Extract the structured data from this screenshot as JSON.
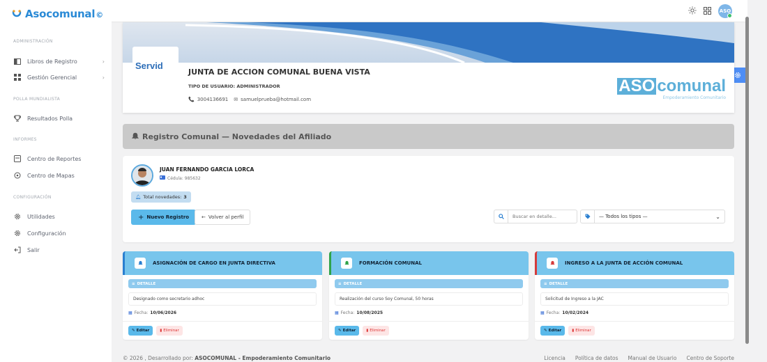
{
  "brand": {
    "name": "Asocomunal",
    "mark": "©"
  },
  "sidebar": {
    "sections": [
      {
        "label": "ADMINISTRACIÓN"
      },
      {
        "label": "POLLA MUNDIALISTA"
      },
      {
        "label": "INFORMES"
      },
      {
        "label": "CONFIGURACIÓN"
      }
    ],
    "items": [
      {
        "label": "Libros de Registro",
        "icon": "book-icon",
        "chevron": "›"
      },
      {
        "label": "Gestión Gerencial",
        "icon": "grid-icon",
        "chevron": "›"
      },
      {
        "label": "Resultados Polla",
        "icon": "trophy-icon"
      },
      {
        "label": "Centro de Reportes",
        "icon": "report-icon"
      },
      {
        "label": "Centro de Mapas",
        "icon": "map-pin-icon"
      },
      {
        "label": "Utilidades",
        "icon": "gear-icon"
      },
      {
        "label": "Configuración",
        "icon": "gear-icon"
      },
      {
        "label": "Salir",
        "icon": "logout-icon"
      }
    ]
  },
  "topbar": {
    "avatar_text": "ASO"
  },
  "banner": {
    "logo_text": "Servid",
    "org_name": "JUNTA DE ACCION COMUNAL BUENA VISTA",
    "user_type": "TIPO DE USUARIO: ADMINISTRADOR",
    "phone": "3004136691",
    "email": "samuelprueba@hotmail.com",
    "aso_logo_box": "ASO",
    "aso_logo_word": "comunal",
    "aso_logo_sub": "Empoderamiento Comunitario"
  },
  "section_header": {
    "title": "Registro Comunal — Novedades del Afiliado"
  },
  "afiliado": {
    "name": "JUAN FERNANDO GARCIA LORCA",
    "cedula": "Cédula: 985632",
    "total_label": "Total novedades:",
    "total_value": "3"
  },
  "actions": {
    "new_label": "Nuevo Registro",
    "back_label": "Volver al perfil",
    "search_placeholder": "Buscar en detalle...",
    "type_select": "— Todos los tipos —"
  },
  "novedades": [
    {
      "title": "ASIGNACIÓN DE CARGO EN JUNTA DIRECTIVA",
      "detail_label": "DETALLE",
      "detail": "Designado como secretario adhoc",
      "fecha_label": "Fecha:",
      "fecha": "10/06/2026",
      "edit": "Editar",
      "delete": "Eliminar",
      "accent": "#2a7fd0"
    },
    {
      "title": "FORMACIÓN COMUNAL",
      "detail_label": "DETALLE",
      "detail": "Realización del curso Soy Comunal, 50 horas",
      "fecha_label": "Fecha:",
      "fecha": "10/08/2025",
      "edit": "Editar",
      "delete": "Eliminar",
      "accent": "#2fa34a"
    },
    {
      "title": "INGRESO A LA JUNTA DE ACCIÓN COMUNAL",
      "detail_label": "DETALLE",
      "detail": "Solicitud de Ingreso a la JAC",
      "fecha_label": "Fecha:",
      "fecha": "10/02/2024",
      "edit": "Editar",
      "delete": "Eliminar",
      "accent": "#d43b3b"
    }
  ],
  "footer": {
    "left": "© 2026 , Desarrollado por:",
    "org": "ASOCOMUNAL - Empoderamiento Comunitario",
    "links": [
      "Licencia",
      "Política de datos",
      "Manual de Usuario",
      "Centro de Soporte"
    ]
  }
}
